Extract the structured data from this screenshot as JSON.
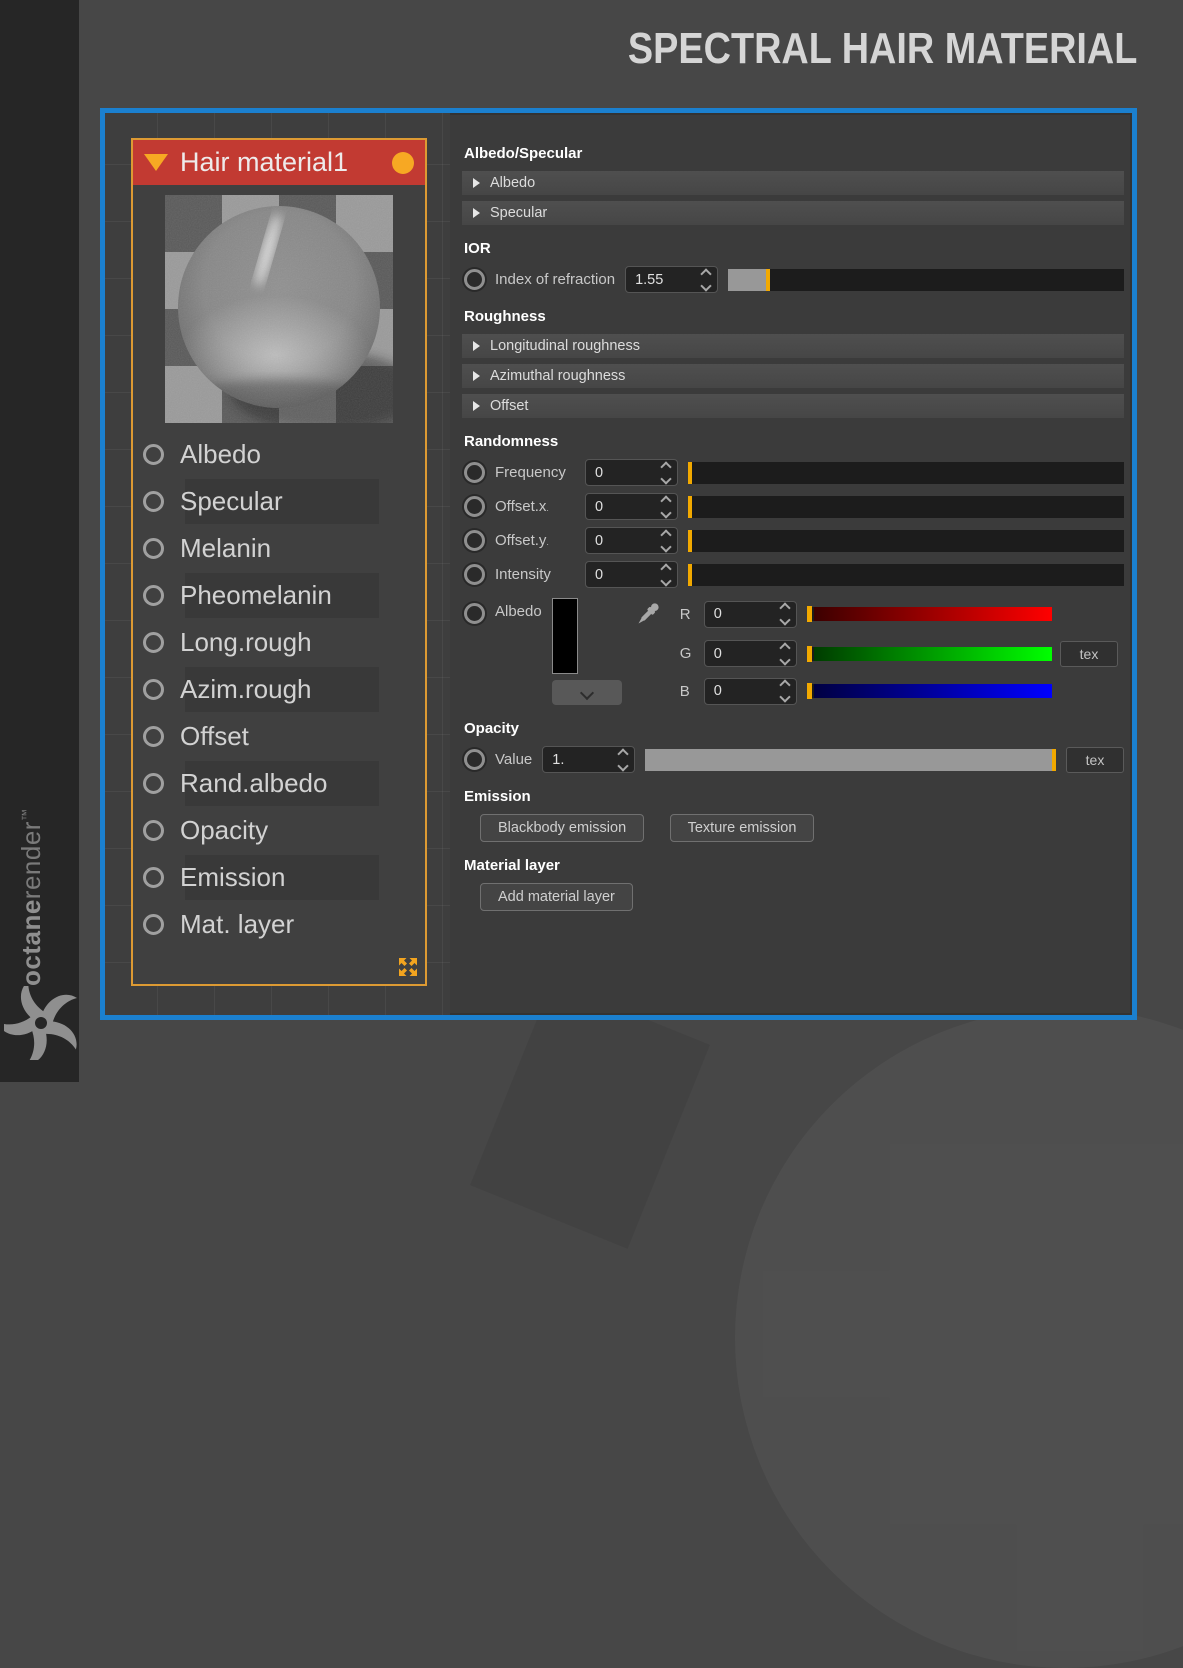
{
  "page": {
    "title": "SPECTRAL HAIR MATERIAL"
  },
  "brand": {
    "name_bold": "octane",
    "name_light": "render",
    "tm": "™"
  },
  "colors": {
    "accent_blue": "#1b80cf",
    "node_header_red": "#c23a32",
    "accent_orange": "#f7a823",
    "slider_handle": "#f2a900",
    "channel_red": "#ff0000",
    "channel_green": "#00ee00",
    "channel_blue": "#0000ee",
    "albedo_swatch": "#000000"
  },
  "node": {
    "title": "Hair material1",
    "inputs": [
      "Albedo",
      "Specular",
      "Melanin",
      "Pheomelanin",
      "Long.rough",
      "Azim.rough",
      "Offset",
      "Rand.albedo",
      "Opacity",
      "Emission",
      "Mat. layer"
    ]
  },
  "panel": {
    "albedo_specular": {
      "heading": "Albedo/Specular",
      "groups": [
        "Albedo",
        "Specular"
      ]
    },
    "ior": {
      "heading": "IOR",
      "row": {
        "label": "Index of refraction",
        "value": "1.55"
      }
    },
    "roughness": {
      "heading": "Roughness",
      "groups": [
        "Longitudinal roughness",
        "Azimuthal roughness",
        "Offset"
      ]
    },
    "randomness": {
      "heading": "Randomness",
      "rows": [
        {
          "label": "Frequency",
          "suffix": "",
          "value": "0"
        },
        {
          "label": "Offset.x",
          "suffix": ".",
          "value": "0"
        },
        {
          "label": "Offset.y",
          "suffix": ".",
          "value": "0"
        },
        {
          "label": "Intensity",
          "suffix": "",
          "value": "0"
        }
      ],
      "albedo": {
        "label": "Albedo",
        "channels": [
          {
            "letter": "R",
            "value": "0"
          },
          {
            "letter": "G",
            "value": "0"
          },
          {
            "letter": "B",
            "value": "0"
          }
        ],
        "tex_label": "tex"
      }
    },
    "opacity": {
      "heading": "Opacity",
      "row": {
        "label": "Value",
        "value": "1."
      },
      "tex_label": "tex"
    },
    "emission": {
      "heading": "Emission",
      "buttons": [
        "Blackbody emission",
        "Texture emission"
      ]
    },
    "material_layer": {
      "heading": "Material layer",
      "button": "Add material layer"
    }
  }
}
